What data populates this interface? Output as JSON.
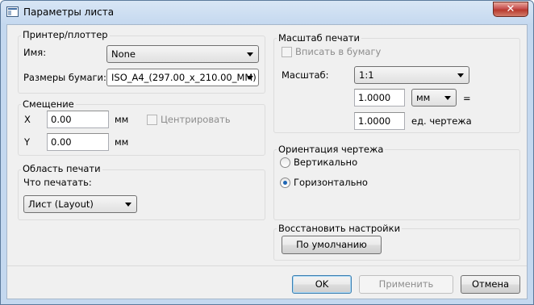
{
  "window": {
    "title": "Параметры листа",
    "close_glyph": "✕"
  },
  "printer": {
    "group_label": "Принтер/плоттер",
    "name_label": "Имя:",
    "name_value": "None",
    "paper_label": "Размеры бумаги:",
    "paper_value": "ISO_A4_(297.00_x_210.00_MM)"
  },
  "offset": {
    "group_label": "Смещение",
    "x_label": "X",
    "x_value": "0.00",
    "x_unit": "мм",
    "y_label": "Y",
    "y_value": "0.00",
    "y_unit": "мм",
    "center_label": "Центрировать",
    "center_checked": false
  },
  "print_area": {
    "group_label": "Область печати",
    "what_label": "Что печатать:",
    "what_value": "Лист (Layout)"
  },
  "scale": {
    "group_label": "Масштаб печати",
    "fit_label": "Вписать в бумагу",
    "fit_checked": false,
    "scale_label": "Масштаб:",
    "scale_value": "1:1",
    "units_value_1": "1.0000",
    "units_combo": "мм",
    "equals": "=",
    "units_value_2": "1.0000",
    "drawing_units_label": "ед. чертежа"
  },
  "orientation": {
    "group_label": "Ориентация чертежа",
    "portrait_label": "Вертикально",
    "landscape_label": "Горизонтально",
    "selected": "landscape"
  },
  "restore": {
    "group_label": "Восстановить настройки",
    "default_button": "По умолчанию"
  },
  "buttons": {
    "ok": "OK",
    "apply": "Применить",
    "cancel": "Отмена"
  }
}
